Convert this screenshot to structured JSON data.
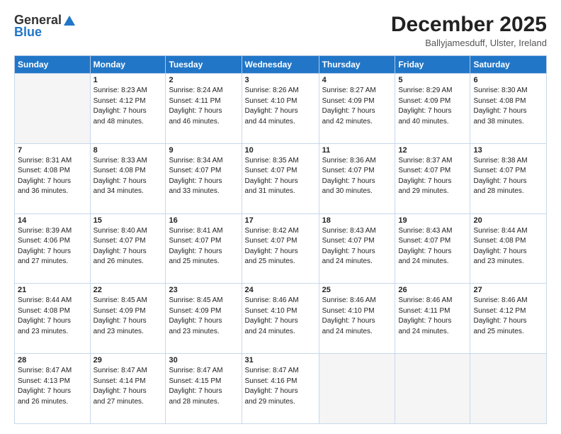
{
  "logo": {
    "line1": "General",
    "line2": "Blue"
  },
  "header": {
    "title": "December 2025",
    "subtitle": "Ballyjamesduff, Ulster, Ireland"
  },
  "weekdays": [
    "Sunday",
    "Monday",
    "Tuesday",
    "Wednesday",
    "Thursday",
    "Friday",
    "Saturday"
  ],
  "weeks": [
    [
      {
        "day": "",
        "info": ""
      },
      {
        "day": "1",
        "info": "Sunrise: 8:23 AM\nSunset: 4:12 PM\nDaylight: 7 hours\nand 48 minutes."
      },
      {
        "day": "2",
        "info": "Sunrise: 8:24 AM\nSunset: 4:11 PM\nDaylight: 7 hours\nand 46 minutes."
      },
      {
        "day": "3",
        "info": "Sunrise: 8:26 AM\nSunset: 4:10 PM\nDaylight: 7 hours\nand 44 minutes."
      },
      {
        "day": "4",
        "info": "Sunrise: 8:27 AM\nSunset: 4:09 PM\nDaylight: 7 hours\nand 42 minutes."
      },
      {
        "day": "5",
        "info": "Sunrise: 8:29 AM\nSunset: 4:09 PM\nDaylight: 7 hours\nand 40 minutes."
      },
      {
        "day": "6",
        "info": "Sunrise: 8:30 AM\nSunset: 4:08 PM\nDaylight: 7 hours\nand 38 minutes."
      }
    ],
    [
      {
        "day": "7",
        "info": "Sunrise: 8:31 AM\nSunset: 4:08 PM\nDaylight: 7 hours\nand 36 minutes."
      },
      {
        "day": "8",
        "info": "Sunrise: 8:33 AM\nSunset: 4:08 PM\nDaylight: 7 hours\nand 34 minutes."
      },
      {
        "day": "9",
        "info": "Sunrise: 8:34 AM\nSunset: 4:07 PM\nDaylight: 7 hours\nand 33 minutes."
      },
      {
        "day": "10",
        "info": "Sunrise: 8:35 AM\nSunset: 4:07 PM\nDaylight: 7 hours\nand 31 minutes."
      },
      {
        "day": "11",
        "info": "Sunrise: 8:36 AM\nSunset: 4:07 PM\nDaylight: 7 hours\nand 30 minutes."
      },
      {
        "day": "12",
        "info": "Sunrise: 8:37 AM\nSunset: 4:07 PM\nDaylight: 7 hours\nand 29 minutes."
      },
      {
        "day": "13",
        "info": "Sunrise: 8:38 AM\nSunset: 4:07 PM\nDaylight: 7 hours\nand 28 minutes."
      }
    ],
    [
      {
        "day": "14",
        "info": "Sunrise: 8:39 AM\nSunset: 4:06 PM\nDaylight: 7 hours\nand 27 minutes."
      },
      {
        "day": "15",
        "info": "Sunrise: 8:40 AM\nSunset: 4:07 PM\nDaylight: 7 hours\nand 26 minutes."
      },
      {
        "day": "16",
        "info": "Sunrise: 8:41 AM\nSunset: 4:07 PM\nDaylight: 7 hours\nand 25 minutes."
      },
      {
        "day": "17",
        "info": "Sunrise: 8:42 AM\nSunset: 4:07 PM\nDaylight: 7 hours\nand 25 minutes."
      },
      {
        "day": "18",
        "info": "Sunrise: 8:43 AM\nSunset: 4:07 PM\nDaylight: 7 hours\nand 24 minutes."
      },
      {
        "day": "19",
        "info": "Sunrise: 8:43 AM\nSunset: 4:07 PM\nDaylight: 7 hours\nand 24 minutes."
      },
      {
        "day": "20",
        "info": "Sunrise: 8:44 AM\nSunset: 4:08 PM\nDaylight: 7 hours\nand 23 minutes."
      }
    ],
    [
      {
        "day": "21",
        "info": "Sunrise: 8:44 AM\nSunset: 4:08 PM\nDaylight: 7 hours\nand 23 minutes."
      },
      {
        "day": "22",
        "info": "Sunrise: 8:45 AM\nSunset: 4:09 PM\nDaylight: 7 hours\nand 23 minutes."
      },
      {
        "day": "23",
        "info": "Sunrise: 8:45 AM\nSunset: 4:09 PM\nDaylight: 7 hours\nand 23 minutes."
      },
      {
        "day": "24",
        "info": "Sunrise: 8:46 AM\nSunset: 4:10 PM\nDaylight: 7 hours\nand 24 minutes."
      },
      {
        "day": "25",
        "info": "Sunrise: 8:46 AM\nSunset: 4:10 PM\nDaylight: 7 hours\nand 24 minutes."
      },
      {
        "day": "26",
        "info": "Sunrise: 8:46 AM\nSunset: 4:11 PM\nDaylight: 7 hours\nand 24 minutes."
      },
      {
        "day": "27",
        "info": "Sunrise: 8:46 AM\nSunset: 4:12 PM\nDaylight: 7 hours\nand 25 minutes."
      }
    ],
    [
      {
        "day": "28",
        "info": "Sunrise: 8:47 AM\nSunset: 4:13 PM\nDaylight: 7 hours\nand 26 minutes."
      },
      {
        "day": "29",
        "info": "Sunrise: 8:47 AM\nSunset: 4:14 PM\nDaylight: 7 hours\nand 27 minutes."
      },
      {
        "day": "30",
        "info": "Sunrise: 8:47 AM\nSunset: 4:15 PM\nDaylight: 7 hours\nand 28 minutes."
      },
      {
        "day": "31",
        "info": "Sunrise: 8:47 AM\nSunset: 4:16 PM\nDaylight: 7 hours\nand 29 minutes."
      },
      {
        "day": "",
        "info": ""
      },
      {
        "day": "",
        "info": ""
      },
      {
        "day": "",
        "info": ""
      }
    ]
  ]
}
